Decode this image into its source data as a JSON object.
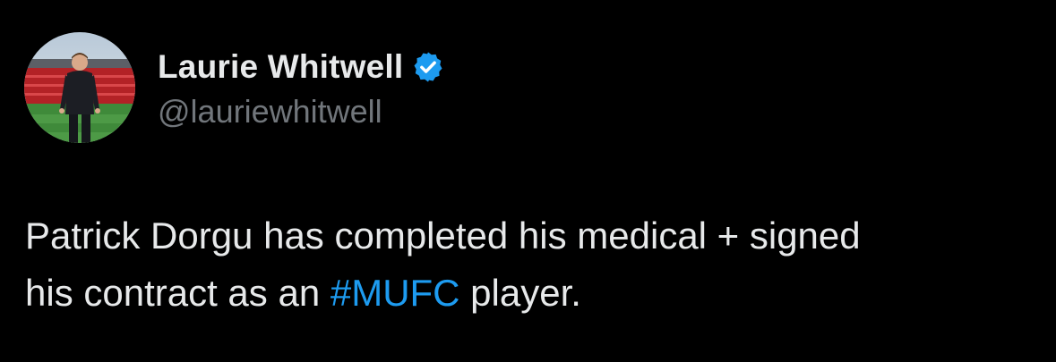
{
  "author": {
    "display_name": "Laurie Whitwell",
    "handle": "@lauriewhitwell",
    "verified": true
  },
  "tweet": {
    "line1": "Patrick Dorgu has completed his medical + signed",
    "line2_before": "his contract as an ",
    "hashtag": "#MUFC",
    "line2_after": " player."
  },
  "icons": {
    "verified_badge": "verified-check-icon"
  },
  "colors": {
    "background": "#000000",
    "text": "#e7e9ea",
    "secondary_text": "#71767b",
    "accent": "#1d9bf0"
  }
}
